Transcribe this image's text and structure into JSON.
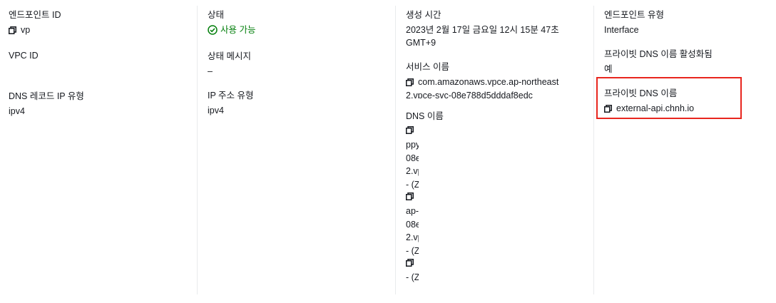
{
  "col1": {
    "endpoint_id": {
      "label": "엔드포인트 ID",
      "value": "vp"
    },
    "vpc_id": {
      "label": "VPC ID",
      "value": ""
    },
    "dns_record_ip_type": {
      "label": "DNS 레코드 IP 유형",
      "value": "ipv4"
    }
  },
  "col2": {
    "status": {
      "label": "상태",
      "value": "사용 가능"
    },
    "status_message": {
      "label": "상태 메시지",
      "value": "–"
    },
    "ip_address_type": {
      "label": "IP 주소 유형",
      "value": "ipv4"
    }
  },
  "col3": {
    "created_time": {
      "label": "생성 시간",
      "value_line1": "2023년 2월 17일 금요일 12시 15분 47초",
      "value_line2": "GMT+9"
    },
    "service_name": {
      "label": "서비스 이름",
      "line1": "com.amazonaws.vpce.ap-northeast",
      "line2": "2.vpce-svc-08e788d5dddaf8edc"
    },
    "dns_names": {
      "label": "DNS 이름",
      "entries": [
        {
          "lines": [
            "ppy",
            "08e",
            "2.vp",
            "- (Z"
          ]
        },
        {
          "lines": [
            "ap-",
            "08e",
            "2.vp",
            "- (Z"
          ]
        },
        {
          "lines": [
            "- (Z"
          ]
        }
      ]
    }
  },
  "col4": {
    "endpoint_type": {
      "label": "엔드포인트 유형",
      "value": "Interface"
    },
    "private_dns_enabled": {
      "label": "프라이빗 DNS 이름 활성화됨",
      "value": "예"
    },
    "private_dns_name": {
      "label": "프라이빗 DNS 이름",
      "value": "external-api.chnh.io"
    }
  },
  "colors": {
    "success": "#037f0c",
    "highlight": "#e8261e",
    "divider": "#e9ebed"
  }
}
